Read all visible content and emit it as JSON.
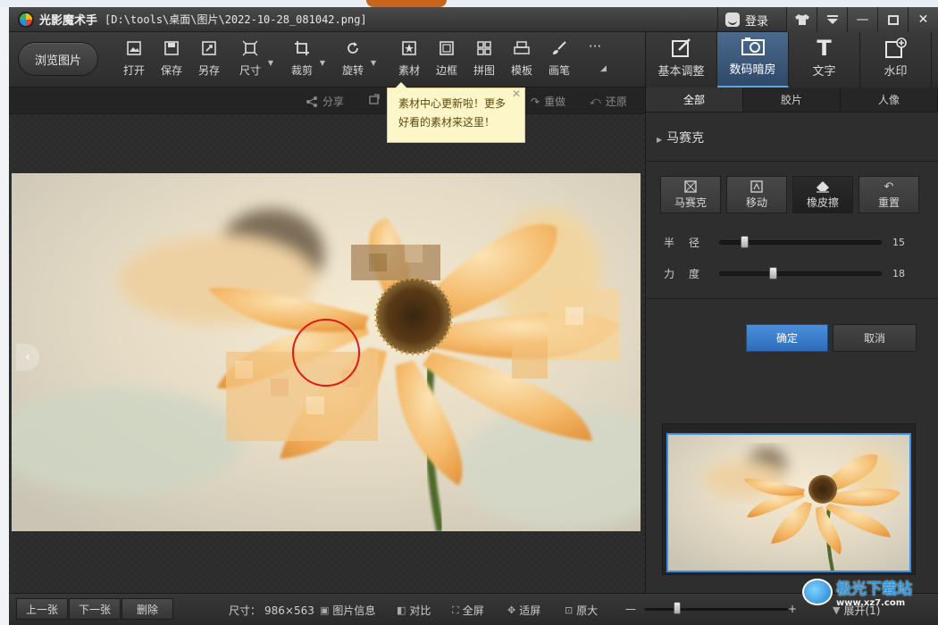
{
  "window": {
    "app_title": "光影魔术手",
    "file_path": "[D:\\tools\\桌面\\图片\\2022-10-28_081042.png]",
    "login_label": "登录",
    "controls": [
      "⬆",
      "▼",
      "—",
      "▢",
      "✕"
    ]
  },
  "toolbar": {
    "browse_label": "浏览图片",
    "tools": [
      {
        "label": "打开"
      },
      {
        "label": "保存"
      },
      {
        "label": "另存"
      },
      {
        "label": "尺寸"
      },
      {
        "label": "裁剪"
      },
      {
        "label": "旋转"
      },
      {
        "label": "素材"
      },
      {
        "label": "边框"
      },
      {
        "label": "拼图"
      },
      {
        "label": "模板"
      },
      {
        "label": "画笔"
      },
      {
        "label": "···"
      }
    ]
  },
  "subbar": {
    "share": "分享",
    "redo": "重做",
    "restore": "还原"
  },
  "tooltip": {
    "text": "素材中心更新啦！更多好看的素材来这里！"
  },
  "right_tabs": [
    {
      "label": "基本调整"
    },
    {
      "label": "数码暗房",
      "active": true
    },
    {
      "label": "文字"
    },
    {
      "label": "水印"
    }
  ],
  "panel": {
    "categories": [
      "全部",
      "胶片",
      "人像"
    ],
    "section_title": "马赛克",
    "mosaic_buttons": [
      "马赛克",
      "移动",
      "橡皮擦",
      "重置"
    ],
    "sliders": [
      {
        "label": "半径",
        "value": "15",
        "level": 0.15
      },
      {
        "label": "力度",
        "value": "18",
        "level": 0.33
      }
    ],
    "ok_label": "确定",
    "cancel_label": "取消"
  },
  "statusbar": {
    "prev_label": "上一张",
    "next_label": "下一张",
    "delete_label": "删除",
    "size_label": "尺寸：",
    "size_value": "986×563",
    "info_label": "图片信息",
    "compare_label": "对比",
    "fullscreen_label": "全屏",
    "fit_label": "适屏",
    "original_label": "原大",
    "zoom_minus": "—",
    "zoom_plus": "+",
    "expand_label": "展开(1)"
  },
  "watermark": {
    "name": "极光下载站",
    "url": "www.xz7.com"
  },
  "colors": {
    "accent": "#3c8ee6",
    "ok_button": "#3a7fd0",
    "brush_circle": "#e01818"
  }
}
